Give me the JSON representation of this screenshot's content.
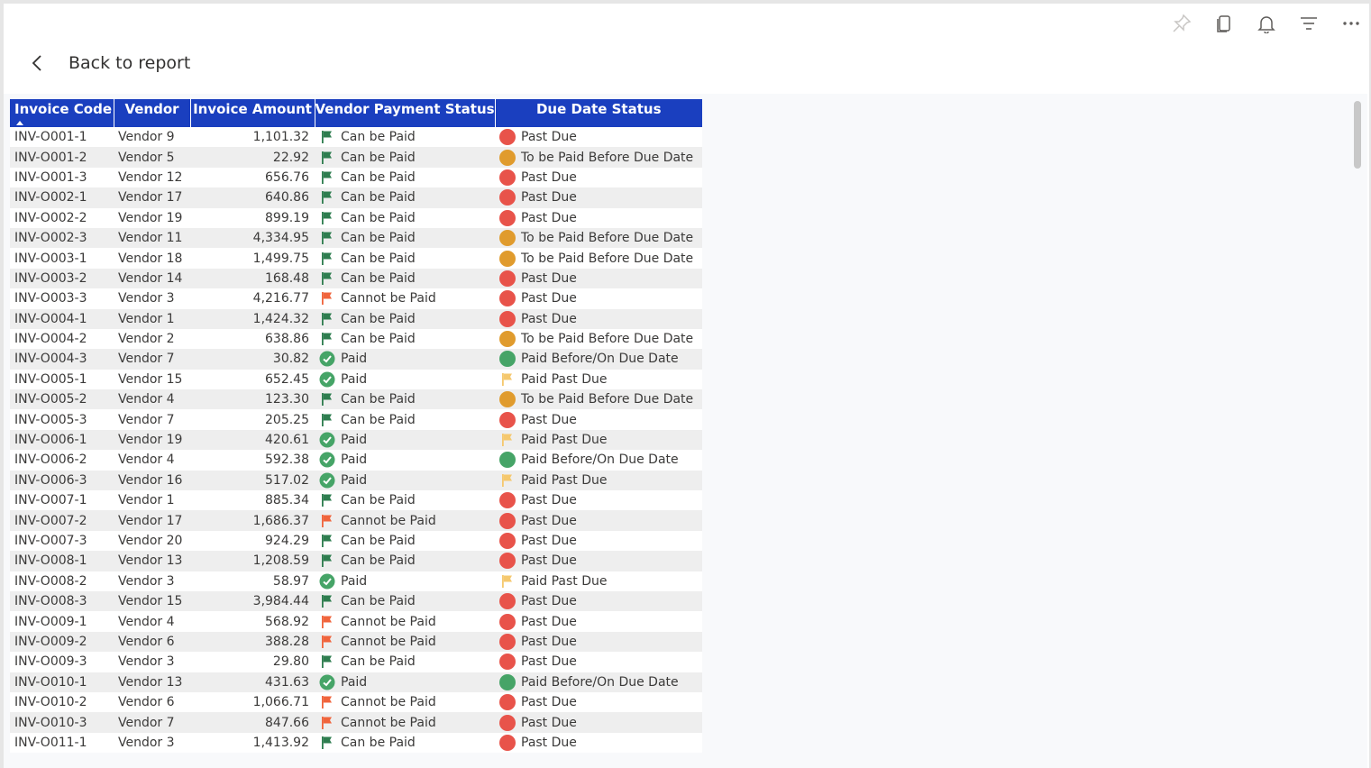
{
  "toolbar": {
    "icons": [
      "pin-icon",
      "copy-icon",
      "bell-icon",
      "filter-icon",
      "more-icon"
    ]
  },
  "back": {
    "label": "Back to report"
  },
  "table": {
    "columns": [
      "Invoice Code",
      "Vendor",
      "Invoice Amount",
      "Vendor Payment Status",
      "Due Date Status"
    ],
    "sorted_column": "Invoice Code",
    "colors": {
      "header_bg": "#1a3fbf",
      "green_flag": "#2e7d4f",
      "red_flag": "#f0643c",
      "yellow_flag": "#f5c86e",
      "red_dot": "#e8534a",
      "orange_dot": "#e09b2d",
      "green_dot": "#46a467",
      "paid_check": "#46a467"
    },
    "rows": [
      {
        "code": "INV-O001-1",
        "vendor": "Vendor 9",
        "amount": "1,101.32",
        "pay": "Can be Paid",
        "pay_icon": "green-flag",
        "due": "Past Due",
        "due_icon": "red-dot"
      },
      {
        "code": "INV-O001-2",
        "vendor": "Vendor 5",
        "amount": "22.92",
        "pay": "Can be Paid",
        "pay_icon": "green-flag",
        "due": "To be Paid Before Due Date",
        "due_icon": "orange-dot"
      },
      {
        "code": "INV-O001-3",
        "vendor": "Vendor 12",
        "amount": "656.76",
        "pay": "Can be Paid",
        "pay_icon": "green-flag",
        "due": "Past Due",
        "due_icon": "red-dot"
      },
      {
        "code": "INV-O002-1",
        "vendor": "Vendor 17",
        "amount": "640.86",
        "pay": "Can be Paid",
        "pay_icon": "green-flag",
        "due": "Past Due",
        "due_icon": "red-dot"
      },
      {
        "code": "INV-O002-2",
        "vendor": "Vendor 19",
        "amount": "899.19",
        "pay": "Can be Paid",
        "pay_icon": "green-flag",
        "due": "Past Due",
        "due_icon": "red-dot"
      },
      {
        "code": "INV-O002-3",
        "vendor": "Vendor 11",
        "amount": "4,334.95",
        "pay": "Can be Paid",
        "pay_icon": "green-flag",
        "due": "To be Paid Before Due Date",
        "due_icon": "orange-dot"
      },
      {
        "code": "INV-O003-1",
        "vendor": "Vendor 18",
        "amount": "1,499.75",
        "pay": "Can be Paid",
        "pay_icon": "green-flag",
        "due": "To be Paid Before Due Date",
        "due_icon": "orange-dot"
      },
      {
        "code": "INV-O003-2",
        "vendor": "Vendor 14",
        "amount": "168.48",
        "pay": "Can be Paid",
        "pay_icon": "green-flag",
        "due": "Past Due",
        "due_icon": "red-dot"
      },
      {
        "code": "INV-O003-3",
        "vendor": "Vendor 3",
        "amount": "4,216.77",
        "pay": "Cannot be Paid",
        "pay_icon": "red-flag",
        "due": "Past Due",
        "due_icon": "red-dot"
      },
      {
        "code": "INV-O004-1",
        "vendor": "Vendor 1",
        "amount": "1,424.32",
        "pay": "Can be Paid",
        "pay_icon": "green-flag",
        "due": "Past Due",
        "due_icon": "red-dot"
      },
      {
        "code": "INV-O004-2",
        "vendor": "Vendor 2",
        "amount": "638.86",
        "pay": "Can be Paid",
        "pay_icon": "green-flag",
        "due": "To be Paid Before Due Date",
        "due_icon": "orange-dot"
      },
      {
        "code": "INV-O004-3",
        "vendor": "Vendor 7",
        "amount": "30.82",
        "pay": "Paid",
        "pay_icon": "check",
        "due": "Paid Before/On Due Date",
        "due_icon": "green-dot"
      },
      {
        "code": "INV-O005-1",
        "vendor": "Vendor 15",
        "amount": "652.45",
        "pay": "Paid",
        "pay_icon": "check",
        "due": "Paid Past Due",
        "due_icon": "yellow-flag"
      },
      {
        "code": "INV-O005-2",
        "vendor": "Vendor 4",
        "amount": "123.30",
        "pay": "Can be Paid",
        "pay_icon": "green-flag",
        "due": "To be Paid Before Due Date",
        "due_icon": "orange-dot"
      },
      {
        "code": "INV-O005-3",
        "vendor": "Vendor 7",
        "amount": "205.25",
        "pay": "Can be Paid",
        "pay_icon": "green-flag",
        "due": "Past Due",
        "due_icon": "red-dot"
      },
      {
        "code": "INV-O006-1",
        "vendor": "Vendor 19",
        "amount": "420.61",
        "pay": "Paid",
        "pay_icon": "check",
        "due": "Paid Past Due",
        "due_icon": "yellow-flag"
      },
      {
        "code": "INV-O006-2",
        "vendor": "Vendor 4",
        "amount": "592.38",
        "pay": "Paid",
        "pay_icon": "check",
        "due": "Paid Before/On Due Date",
        "due_icon": "green-dot"
      },
      {
        "code": "INV-O006-3",
        "vendor": "Vendor 16",
        "amount": "517.02",
        "pay": "Paid",
        "pay_icon": "check",
        "due": "Paid Past Due",
        "due_icon": "yellow-flag"
      },
      {
        "code": "INV-O007-1",
        "vendor": "Vendor 1",
        "amount": "885.34",
        "pay": "Can be Paid",
        "pay_icon": "green-flag",
        "due": "Past Due",
        "due_icon": "red-dot"
      },
      {
        "code": "INV-O007-2",
        "vendor": "Vendor 17",
        "amount": "1,686.37",
        "pay": "Cannot be Paid",
        "pay_icon": "red-flag",
        "due": "Past Due",
        "due_icon": "red-dot"
      },
      {
        "code": "INV-O007-3",
        "vendor": "Vendor 20",
        "amount": "924.29",
        "pay": "Can be Paid",
        "pay_icon": "green-flag",
        "due": "Past Due",
        "due_icon": "red-dot"
      },
      {
        "code": "INV-O008-1",
        "vendor": "Vendor 13",
        "amount": "1,208.59",
        "pay": "Can be Paid",
        "pay_icon": "green-flag",
        "due": "Past Due",
        "due_icon": "red-dot"
      },
      {
        "code": "INV-O008-2",
        "vendor": "Vendor 3",
        "amount": "58.97",
        "pay": "Paid",
        "pay_icon": "check",
        "due": "Paid Past Due",
        "due_icon": "yellow-flag"
      },
      {
        "code": "INV-O008-3",
        "vendor": "Vendor 15",
        "amount": "3,984.44",
        "pay": "Can be Paid",
        "pay_icon": "green-flag",
        "due": "Past Due",
        "due_icon": "red-dot"
      },
      {
        "code": "INV-O009-1",
        "vendor": "Vendor 4",
        "amount": "568.92",
        "pay": "Cannot be Paid",
        "pay_icon": "red-flag",
        "due": "Past Due",
        "due_icon": "red-dot"
      },
      {
        "code": "INV-O009-2",
        "vendor": "Vendor 6",
        "amount": "388.28",
        "pay": "Cannot be Paid",
        "pay_icon": "red-flag",
        "due": "Past Due",
        "due_icon": "red-dot"
      },
      {
        "code": "INV-O009-3",
        "vendor": "Vendor 3",
        "amount": "29.80",
        "pay": "Can be Paid",
        "pay_icon": "green-flag",
        "due": "Past Due",
        "due_icon": "red-dot"
      },
      {
        "code": "INV-O010-1",
        "vendor": "Vendor 13",
        "amount": "431.63",
        "pay": "Paid",
        "pay_icon": "check",
        "due": "Paid Before/On Due Date",
        "due_icon": "green-dot"
      },
      {
        "code": "INV-O010-2",
        "vendor": "Vendor 6",
        "amount": "1,066.71",
        "pay": "Cannot be Paid",
        "pay_icon": "red-flag",
        "due": "Past Due",
        "due_icon": "red-dot"
      },
      {
        "code": "INV-O010-3",
        "vendor": "Vendor 7",
        "amount": "847.66",
        "pay": "Cannot be Paid",
        "pay_icon": "red-flag",
        "due": "Past Due",
        "due_icon": "red-dot"
      },
      {
        "code": "INV-O011-1",
        "vendor": "Vendor 3",
        "amount": "1,413.92",
        "pay": "Can be Paid",
        "pay_icon": "green-flag",
        "due": "Past Due",
        "due_icon": "red-dot"
      }
    ]
  }
}
